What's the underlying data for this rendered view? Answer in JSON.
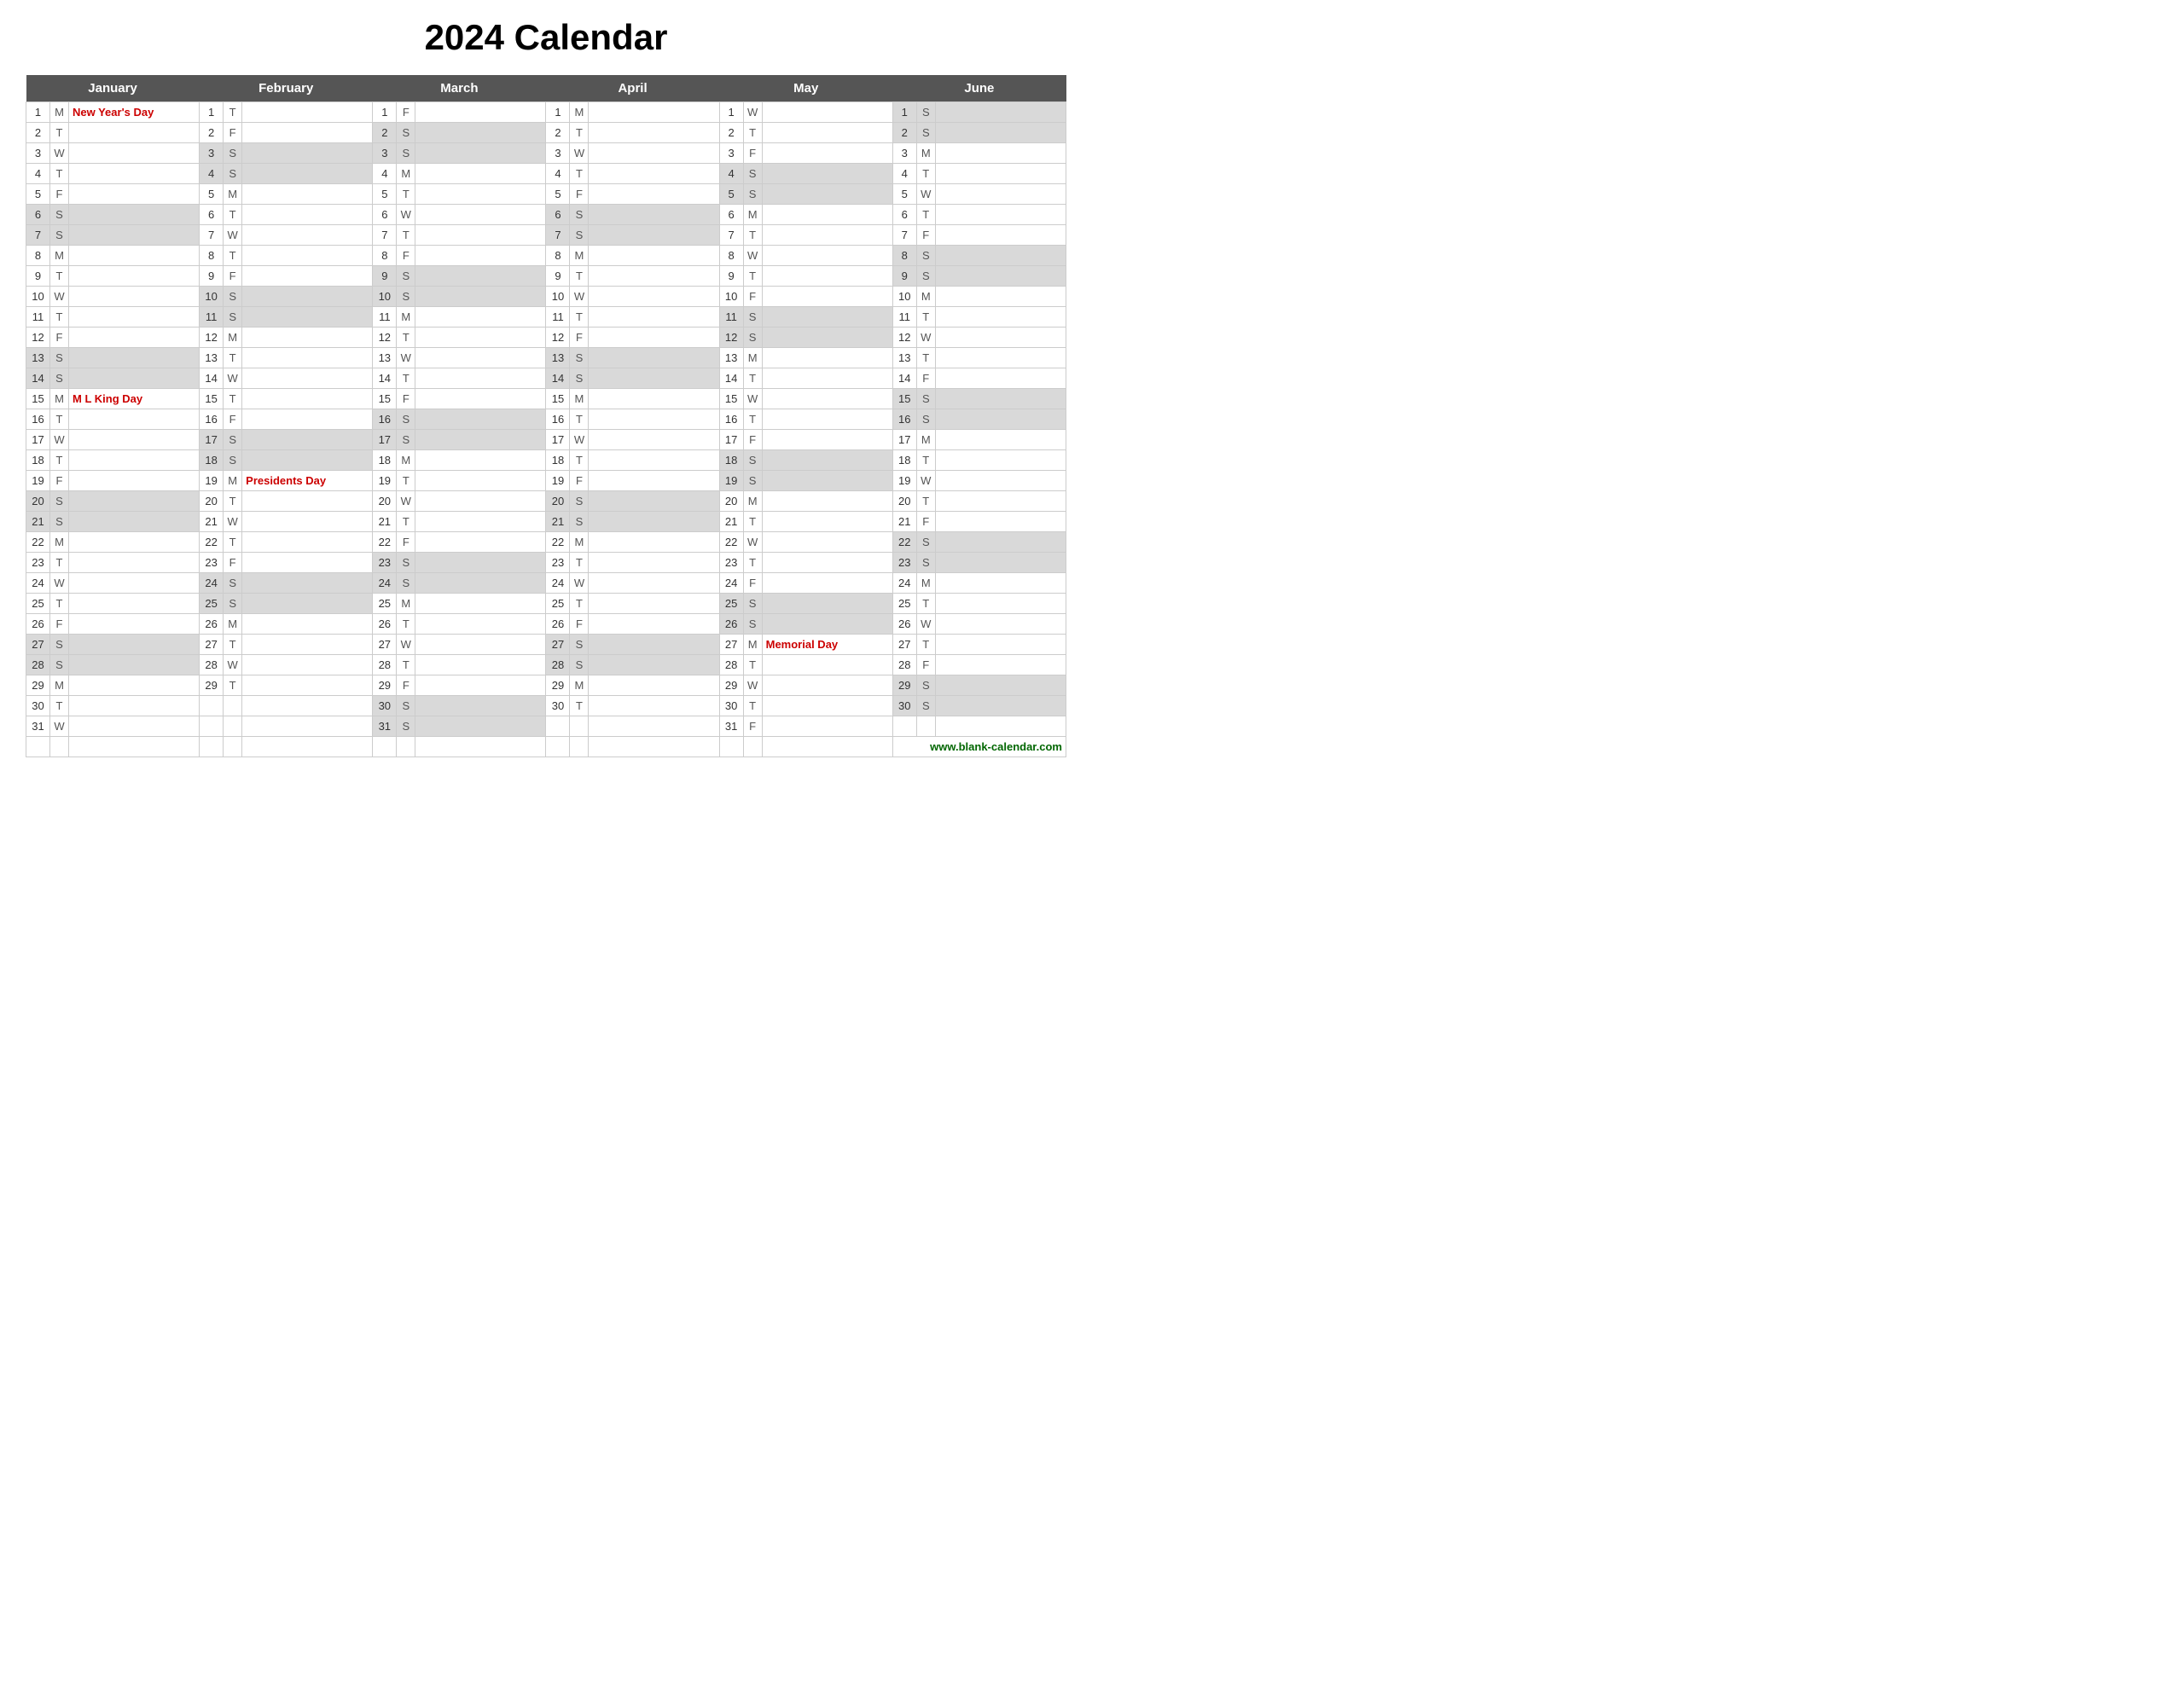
{
  "title": "2024 Calendar",
  "months": [
    "January",
    "February",
    "March",
    "April",
    "May",
    "June"
  ],
  "website": "www.blank-calendar.com",
  "days_of_week": [
    "M",
    "T",
    "W",
    "T",
    "F",
    "S",
    "S"
  ],
  "calendar": {
    "january": [
      {
        "d": 1,
        "dow": "M",
        "holiday": "New Year's Day",
        "isWeekend": false
      },
      {
        "d": 2,
        "dow": "T",
        "holiday": "",
        "isWeekend": false
      },
      {
        "d": 3,
        "dow": "W",
        "holiday": "",
        "isWeekend": false
      },
      {
        "d": 4,
        "dow": "T",
        "holiday": "",
        "isWeekend": false
      },
      {
        "d": 5,
        "dow": "F",
        "holiday": "",
        "isWeekend": false
      },
      {
        "d": 6,
        "dow": "S",
        "holiday": "",
        "isWeekend": true
      },
      {
        "d": 7,
        "dow": "S",
        "holiday": "",
        "isWeekend": true
      },
      {
        "d": 8,
        "dow": "M",
        "holiday": "",
        "isWeekend": false
      },
      {
        "d": 9,
        "dow": "T",
        "holiday": "",
        "isWeekend": false
      },
      {
        "d": 10,
        "dow": "W",
        "holiday": "",
        "isWeekend": false
      },
      {
        "d": 11,
        "dow": "T",
        "holiday": "",
        "isWeekend": false
      },
      {
        "d": 12,
        "dow": "F",
        "holiday": "",
        "isWeekend": false
      },
      {
        "d": 13,
        "dow": "S",
        "holiday": "",
        "isWeekend": true
      },
      {
        "d": 14,
        "dow": "S",
        "holiday": "",
        "isWeekend": true
      },
      {
        "d": 15,
        "dow": "M",
        "holiday": "M L King Day",
        "isWeekend": false
      },
      {
        "d": 16,
        "dow": "T",
        "holiday": "",
        "isWeekend": false
      },
      {
        "d": 17,
        "dow": "W",
        "holiday": "",
        "isWeekend": false
      },
      {
        "d": 18,
        "dow": "T",
        "holiday": "",
        "isWeekend": false
      },
      {
        "d": 19,
        "dow": "F",
        "holiday": "",
        "isWeekend": false
      },
      {
        "d": 20,
        "dow": "S",
        "holiday": "",
        "isWeekend": true
      },
      {
        "d": 21,
        "dow": "S",
        "holiday": "",
        "isWeekend": true
      },
      {
        "d": 22,
        "dow": "M",
        "holiday": "",
        "isWeekend": false
      },
      {
        "d": 23,
        "dow": "T",
        "holiday": "",
        "isWeekend": false
      },
      {
        "d": 24,
        "dow": "W",
        "holiday": "",
        "isWeekend": false
      },
      {
        "d": 25,
        "dow": "T",
        "holiday": "",
        "isWeekend": false
      },
      {
        "d": 26,
        "dow": "F",
        "holiday": "",
        "isWeekend": false
      },
      {
        "d": 27,
        "dow": "S",
        "holiday": "",
        "isWeekend": true
      },
      {
        "d": 28,
        "dow": "S",
        "holiday": "",
        "isWeekend": true
      },
      {
        "d": 29,
        "dow": "M",
        "holiday": "",
        "isWeekend": false
      },
      {
        "d": 30,
        "dow": "T",
        "holiday": "",
        "isWeekend": false
      },
      {
        "d": 31,
        "dow": "W",
        "holiday": "",
        "isWeekend": false
      }
    ],
    "february": [
      {
        "d": 1,
        "dow": "T",
        "holiday": "",
        "isWeekend": false
      },
      {
        "d": 2,
        "dow": "F",
        "holiday": "",
        "isWeekend": false
      },
      {
        "d": 3,
        "dow": "S",
        "holiday": "",
        "isWeekend": true
      },
      {
        "d": 4,
        "dow": "S",
        "holiday": "",
        "isWeekend": true
      },
      {
        "d": 5,
        "dow": "M",
        "holiday": "",
        "isWeekend": false
      },
      {
        "d": 6,
        "dow": "T",
        "holiday": "",
        "isWeekend": false
      },
      {
        "d": 7,
        "dow": "W",
        "holiday": "",
        "isWeekend": false
      },
      {
        "d": 8,
        "dow": "T",
        "holiday": "",
        "isWeekend": false
      },
      {
        "d": 9,
        "dow": "F",
        "holiday": "",
        "isWeekend": false
      },
      {
        "d": 10,
        "dow": "S",
        "holiday": "",
        "isWeekend": true
      },
      {
        "d": 11,
        "dow": "S",
        "holiday": "",
        "isWeekend": true
      },
      {
        "d": 12,
        "dow": "M",
        "holiday": "",
        "isWeekend": false
      },
      {
        "d": 13,
        "dow": "T",
        "holiday": "",
        "isWeekend": false
      },
      {
        "d": 14,
        "dow": "W",
        "holiday": "",
        "isWeekend": false
      },
      {
        "d": 15,
        "dow": "T",
        "holiday": "",
        "isWeekend": false
      },
      {
        "d": 16,
        "dow": "F",
        "holiday": "",
        "isWeekend": false
      },
      {
        "d": 17,
        "dow": "S",
        "holiday": "",
        "isWeekend": true
      },
      {
        "d": 18,
        "dow": "S",
        "holiday": "",
        "isWeekend": true
      },
      {
        "d": 19,
        "dow": "M",
        "holiday": "Presidents Day",
        "isWeekend": false
      },
      {
        "d": 20,
        "dow": "T",
        "holiday": "",
        "isWeekend": false
      },
      {
        "d": 21,
        "dow": "W",
        "holiday": "",
        "isWeekend": false
      },
      {
        "d": 22,
        "dow": "T",
        "holiday": "",
        "isWeekend": false
      },
      {
        "d": 23,
        "dow": "F",
        "holiday": "",
        "isWeekend": false
      },
      {
        "d": 24,
        "dow": "S",
        "holiday": "",
        "isWeekend": true
      },
      {
        "d": 25,
        "dow": "S",
        "holiday": "",
        "isWeekend": true
      },
      {
        "d": 26,
        "dow": "M",
        "holiday": "",
        "isWeekend": false
      },
      {
        "d": 27,
        "dow": "T",
        "holiday": "",
        "isWeekend": false
      },
      {
        "d": 28,
        "dow": "W",
        "holiday": "",
        "isWeekend": false
      },
      {
        "d": 29,
        "dow": "T",
        "holiday": "",
        "isWeekend": false
      }
    ],
    "march": [
      {
        "d": 1,
        "dow": "F",
        "holiday": "",
        "isWeekend": false
      },
      {
        "d": 2,
        "dow": "S",
        "holiday": "",
        "isWeekend": true
      },
      {
        "d": 3,
        "dow": "S",
        "holiday": "",
        "isWeekend": true
      },
      {
        "d": 4,
        "dow": "M",
        "holiday": "",
        "isWeekend": false
      },
      {
        "d": 5,
        "dow": "T",
        "holiday": "",
        "isWeekend": false
      },
      {
        "d": 6,
        "dow": "W",
        "holiday": "",
        "isWeekend": false
      },
      {
        "d": 7,
        "dow": "T",
        "holiday": "",
        "isWeekend": false
      },
      {
        "d": 8,
        "dow": "F",
        "holiday": "",
        "isWeekend": false
      },
      {
        "d": 9,
        "dow": "S",
        "holiday": "",
        "isWeekend": true
      },
      {
        "d": 10,
        "dow": "S",
        "holiday": "",
        "isWeekend": true
      },
      {
        "d": 11,
        "dow": "M",
        "holiday": "",
        "isWeekend": false
      },
      {
        "d": 12,
        "dow": "T",
        "holiday": "",
        "isWeekend": false
      },
      {
        "d": 13,
        "dow": "W",
        "holiday": "",
        "isWeekend": false
      },
      {
        "d": 14,
        "dow": "T",
        "holiday": "",
        "isWeekend": false
      },
      {
        "d": 15,
        "dow": "F",
        "holiday": "",
        "isWeekend": false
      },
      {
        "d": 16,
        "dow": "S",
        "holiday": "",
        "isWeekend": true
      },
      {
        "d": 17,
        "dow": "S",
        "holiday": "",
        "isWeekend": true
      },
      {
        "d": 18,
        "dow": "M",
        "holiday": "",
        "isWeekend": false
      },
      {
        "d": 19,
        "dow": "T",
        "holiday": "",
        "isWeekend": false
      },
      {
        "d": 20,
        "dow": "W",
        "holiday": "",
        "isWeekend": false
      },
      {
        "d": 21,
        "dow": "T",
        "holiday": "",
        "isWeekend": false
      },
      {
        "d": 22,
        "dow": "F",
        "holiday": "",
        "isWeekend": false
      },
      {
        "d": 23,
        "dow": "S",
        "holiday": "",
        "isWeekend": true
      },
      {
        "d": 24,
        "dow": "S",
        "holiday": "",
        "isWeekend": true
      },
      {
        "d": 25,
        "dow": "M",
        "holiday": "",
        "isWeekend": false
      },
      {
        "d": 26,
        "dow": "T",
        "holiday": "",
        "isWeekend": false
      },
      {
        "d": 27,
        "dow": "W",
        "holiday": "",
        "isWeekend": false
      },
      {
        "d": 28,
        "dow": "T",
        "holiday": "",
        "isWeekend": false
      },
      {
        "d": 29,
        "dow": "F",
        "holiday": "",
        "isWeekend": false
      },
      {
        "d": 30,
        "dow": "S",
        "holiday": "",
        "isWeekend": true
      },
      {
        "d": 31,
        "dow": "S",
        "holiday": "",
        "isWeekend": true
      }
    ],
    "april": [
      {
        "d": 1,
        "dow": "M",
        "holiday": "",
        "isWeekend": false
      },
      {
        "d": 2,
        "dow": "T",
        "holiday": "",
        "isWeekend": false
      },
      {
        "d": 3,
        "dow": "W",
        "holiday": "",
        "isWeekend": false
      },
      {
        "d": 4,
        "dow": "T",
        "holiday": "",
        "isWeekend": false
      },
      {
        "d": 5,
        "dow": "F",
        "holiday": "",
        "isWeekend": false
      },
      {
        "d": 6,
        "dow": "S",
        "holiday": "",
        "isWeekend": true
      },
      {
        "d": 7,
        "dow": "S",
        "holiday": "",
        "isWeekend": true
      },
      {
        "d": 8,
        "dow": "M",
        "holiday": "",
        "isWeekend": false
      },
      {
        "d": 9,
        "dow": "T",
        "holiday": "",
        "isWeekend": false
      },
      {
        "d": 10,
        "dow": "W",
        "holiday": "",
        "isWeekend": false
      },
      {
        "d": 11,
        "dow": "T",
        "holiday": "",
        "isWeekend": false
      },
      {
        "d": 12,
        "dow": "F",
        "holiday": "",
        "isWeekend": false
      },
      {
        "d": 13,
        "dow": "S",
        "holiday": "",
        "isWeekend": true
      },
      {
        "d": 14,
        "dow": "S",
        "holiday": "",
        "isWeekend": true
      },
      {
        "d": 15,
        "dow": "M",
        "holiday": "",
        "isWeekend": false
      },
      {
        "d": 16,
        "dow": "T",
        "holiday": "",
        "isWeekend": false
      },
      {
        "d": 17,
        "dow": "W",
        "holiday": "",
        "isWeekend": false
      },
      {
        "d": 18,
        "dow": "T",
        "holiday": "",
        "isWeekend": false
      },
      {
        "d": 19,
        "dow": "F",
        "holiday": "",
        "isWeekend": false
      },
      {
        "d": 20,
        "dow": "S",
        "holiday": "",
        "isWeekend": true
      },
      {
        "d": 21,
        "dow": "S",
        "holiday": "",
        "isWeekend": true
      },
      {
        "d": 22,
        "dow": "M",
        "holiday": "",
        "isWeekend": false
      },
      {
        "d": 23,
        "dow": "T",
        "holiday": "",
        "isWeekend": false
      },
      {
        "d": 24,
        "dow": "W",
        "holiday": "",
        "isWeekend": false
      },
      {
        "d": 25,
        "dow": "T",
        "holiday": "",
        "isWeekend": false
      },
      {
        "d": 26,
        "dow": "F",
        "holiday": "",
        "isWeekend": false
      },
      {
        "d": 27,
        "dow": "S",
        "holiday": "",
        "isWeekend": true
      },
      {
        "d": 28,
        "dow": "S",
        "holiday": "",
        "isWeekend": true
      },
      {
        "d": 29,
        "dow": "M",
        "holiday": "",
        "isWeekend": false
      },
      {
        "d": 30,
        "dow": "T",
        "holiday": "",
        "isWeekend": false
      }
    ],
    "may": [
      {
        "d": 1,
        "dow": "W",
        "holiday": "",
        "isWeekend": false
      },
      {
        "d": 2,
        "dow": "T",
        "holiday": "",
        "isWeekend": false
      },
      {
        "d": 3,
        "dow": "F",
        "holiday": "",
        "isWeekend": false
      },
      {
        "d": 4,
        "dow": "S",
        "holiday": "",
        "isWeekend": true
      },
      {
        "d": 5,
        "dow": "S",
        "holiday": "",
        "isWeekend": true
      },
      {
        "d": 6,
        "dow": "M",
        "holiday": "",
        "isWeekend": false
      },
      {
        "d": 7,
        "dow": "T",
        "holiday": "",
        "isWeekend": false
      },
      {
        "d": 8,
        "dow": "W",
        "holiday": "",
        "isWeekend": false
      },
      {
        "d": 9,
        "dow": "T",
        "holiday": "",
        "isWeekend": false
      },
      {
        "d": 10,
        "dow": "F",
        "holiday": "",
        "isWeekend": false
      },
      {
        "d": 11,
        "dow": "S",
        "holiday": "",
        "isWeekend": true
      },
      {
        "d": 12,
        "dow": "S",
        "holiday": "",
        "isWeekend": true
      },
      {
        "d": 13,
        "dow": "M",
        "holiday": "",
        "isWeekend": false
      },
      {
        "d": 14,
        "dow": "T",
        "holiday": "",
        "isWeekend": false
      },
      {
        "d": 15,
        "dow": "W",
        "holiday": "",
        "isWeekend": false
      },
      {
        "d": 16,
        "dow": "T",
        "holiday": "",
        "isWeekend": false
      },
      {
        "d": 17,
        "dow": "F",
        "holiday": "",
        "isWeekend": false
      },
      {
        "d": 18,
        "dow": "S",
        "holiday": "",
        "isWeekend": true
      },
      {
        "d": 19,
        "dow": "S",
        "holiday": "",
        "isWeekend": true
      },
      {
        "d": 20,
        "dow": "M",
        "holiday": "",
        "isWeekend": false
      },
      {
        "d": 21,
        "dow": "T",
        "holiday": "",
        "isWeekend": false
      },
      {
        "d": 22,
        "dow": "W",
        "holiday": "",
        "isWeekend": false
      },
      {
        "d": 23,
        "dow": "T",
        "holiday": "",
        "isWeekend": false
      },
      {
        "d": 24,
        "dow": "F",
        "holiday": "",
        "isWeekend": false
      },
      {
        "d": 25,
        "dow": "S",
        "holiday": "",
        "isWeekend": true
      },
      {
        "d": 26,
        "dow": "S",
        "holiday": "",
        "isWeekend": true
      },
      {
        "d": 27,
        "dow": "M",
        "holiday": "Memorial Day",
        "isWeekend": false
      },
      {
        "d": 28,
        "dow": "T",
        "holiday": "",
        "isWeekend": false
      },
      {
        "d": 29,
        "dow": "W",
        "holiday": "",
        "isWeekend": false
      },
      {
        "d": 30,
        "dow": "T",
        "holiday": "",
        "isWeekend": false
      },
      {
        "d": 31,
        "dow": "F",
        "holiday": "",
        "isWeekend": false
      }
    ],
    "june": [
      {
        "d": 1,
        "dow": "S",
        "holiday": "",
        "isWeekend": true
      },
      {
        "d": 2,
        "dow": "S",
        "holiday": "",
        "isWeekend": true
      },
      {
        "d": 3,
        "dow": "M",
        "holiday": "",
        "isWeekend": false
      },
      {
        "d": 4,
        "dow": "T",
        "holiday": "",
        "isWeekend": false
      },
      {
        "d": 5,
        "dow": "W",
        "holiday": "",
        "isWeekend": false
      },
      {
        "d": 6,
        "dow": "T",
        "holiday": "",
        "isWeekend": false
      },
      {
        "d": 7,
        "dow": "F",
        "holiday": "",
        "isWeekend": false
      },
      {
        "d": 8,
        "dow": "S",
        "holiday": "",
        "isWeekend": true
      },
      {
        "d": 9,
        "dow": "S",
        "holiday": "",
        "isWeekend": true
      },
      {
        "d": 10,
        "dow": "M",
        "holiday": "",
        "isWeekend": false
      },
      {
        "d": 11,
        "dow": "T",
        "holiday": "",
        "isWeekend": false
      },
      {
        "d": 12,
        "dow": "W",
        "holiday": "",
        "isWeekend": false
      },
      {
        "d": 13,
        "dow": "T",
        "holiday": "",
        "isWeekend": false
      },
      {
        "d": 14,
        "dow": "F",
        "holiday": "",
        "isWeekend": false
      },
      {
        "d": 15,
        "dow": "S",
        "holiday": "",
        "isWeekend": true
      },
      {
        "d": 16,
        "dow": "S",
        "holiday": "",
        "isWeekend": true
      },
      {
        "d": 17,
        "dow": "M",
        "holiday": "",
        "isWeekend": false
      },
      {
        "d": 18,
        "dow": "T",
        "holiday": "",
        "isWeekend": false
      },
      {
        "d": 19,
        "dow": "W",
        "holiday": "",
        "isWeekend": false
      },
      {
        "d": 20,
        "dow": "T",
        "holiday": "",
        "isWeekend": false
      },
      {
        "d": 21,
        "dow": "F",
        "holiday": "",
        "isWeekend": false
      },
      {
        "d": 22,
        "dow": "S",
        "holiday": "",
        "isWeekend": true
      },
      {
        "d": 23,
        "dow": "S",
        "holiday": "",
        "isWeekend": true
      },
      {
        "d": 24,
        "dow": "M",
        "holiday": "",
        "isWeekend": false
      },
      {
        "d": 25,
        "dow": "T",
        "holiday": "",
        "isWeekend": false
      },
      {
        "d": 26,
        "dow": "W",
        "holiday": "",
        "isWeekend": false
      },
      {
        "d": 27,
        "dow": "T",
        "holiday": "",
        "isWeekend": false
      },
      {
        "d": 28,
        "dow": "F",
        "holiday": "",
        "isWeekend": false
      },
      {
        "d": 29,
        "dow": "S",
        "holiday": "",
        "isWeekend": true
      },
      {
        "d": 30,
        "dow": "S",
        "holiday": "",
        "isWeekend": true
      }
    ]
  }
}
